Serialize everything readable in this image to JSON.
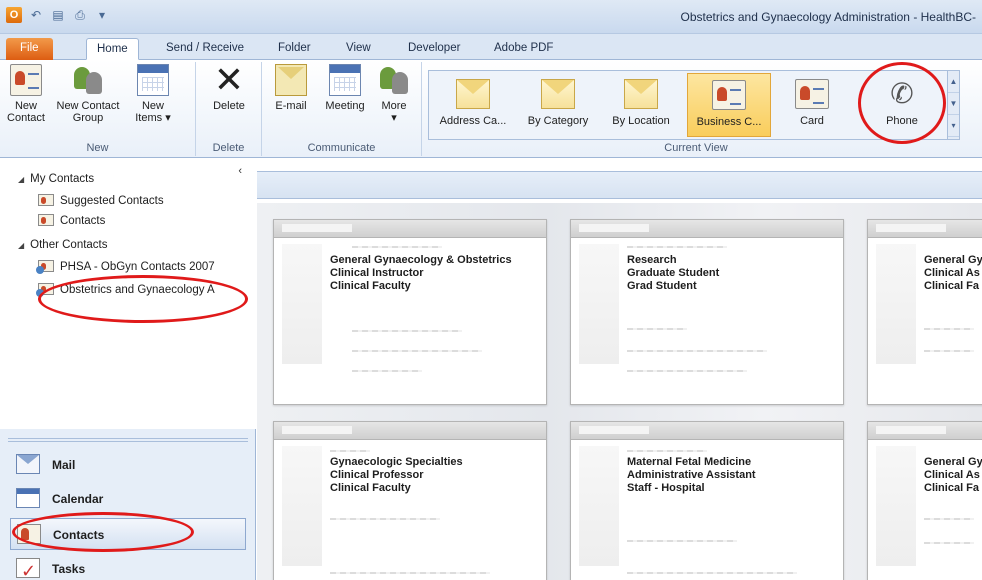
{
  "window": {
    "title": "Obstetrics and Gynaecology Administration - HealthBC-"
  },
  "ribbon_tabs": [
    {
      "label": "File"
    },
    {
      "label": "Home"
    },
    {
      "label": "Send / Receive"
    },
    {
      "label": "Folder"
    },
    {
      "label": "View"
    },
    {
      "label": "Developer"
    },
    {
      "label": "Adobe PDF"
    }
  ],
  "ribbon": {
    "new_group": {
      "label": "New",
      "new_contact": "New\nContact",
      "new_contact_group": "New Contact\nGroup",
      "new_items": "New\nItems ▾"
    },
    "delete_group": {
      "label": "Delete",
      "delete": "Delete"
    },
    "communicate_group": {
      "label": "Communicate",
      "email": "E-mail",
      "meeting": "Meeting",
      "more": "More\n▾"
    },
    "current_view": {
      "label": "Current View",
      "views": [
        {
          "label": "Address Ca..."
        },
        {
          "label": "By Category"
        },
        {
          "label": "By Location"
        },
        {
          "label": "Business C...",
          "selected": true
        },
        {
          "label": "Card"
        },
        {
          "label": "Phone"
        }
      ]
    }
  },
  "navpane": {
    "collapse_glyph": "‹",
    "my_contacts": "My Contacts",
    "my_items": [
      "Suggested Contacts",
      "Contacts"
    ],
    "other_contacts": "Other Contacts",
    "other_items": [
      "PHSA - ObGyn Contacts 2007",
      "Obstetrics and Gynaecology A"
    ],
    "modules": [
      "Mail",
      "Calendar",
      "Contacts",
      "Tasks"
    ],
    "active_module": "Contacts"
  },
  "cards": [
    {
      "lines": [
        "General Gynaecology & Obstetrics",
        "Clinical Instructor",
        "Clinical Faculty"
      ]
    },
    {
      "lines": [
        "Research",
        "Graduate Student",
        "Grad Student"
      ]
    },
    {
      "lines": [
        "General Gy",
        "Clinical As",
        "Clinical Fa"
      ]
    },
    {
      "lines": [
        "Gynaecologic Specialties",
        "Clinical Professor",
        "Clinical Faculty"
      ]
    },
    {
      "lines": [
        "Maternal Fetal Medicine",
        "Administrative Assistant",
        "Staff - Hospital"
      ]
    },
    {
      "lines": [
        "General Gy",
        "Clinical As",
        "Clinical Fa"
      ]
    }
  ],
  "colors": {
    "annotation": "#e01a1a",
    "accent": "#f9cd5c",
    "file_tab": "#dd5d12"
  }
}
